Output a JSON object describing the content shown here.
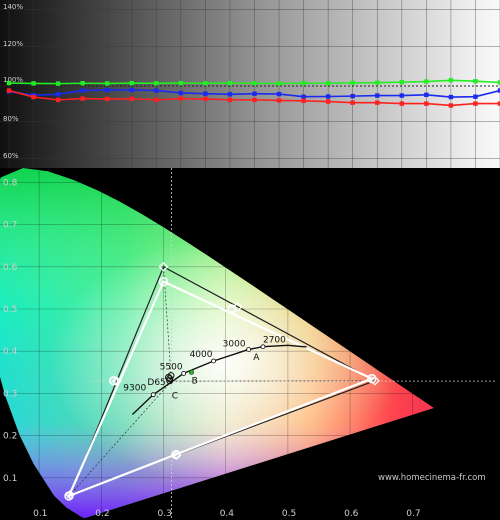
{
  "rgb_balance": {
    "y_ticks": [
      "140%",
      "120%",
      "100%",
      "80%",
      "60%"
    ],
    "colors": {
      "red": "#ff2020",
      "green": "#22ee22",
      "blue": "#1a2aee"
    }
  },
  "cie": {
    "x_ticks": [
      "0.1",
      "0.2",
      "0.3",
      "0.4",
      "0.5",
      "0.6",
      "0.7"
    ],
    "y_ticks": [
      "0.8",
      "0.7",
      "0.6",
      "0.5",
      "0.4",
      "0.3",
      "0.2",
      "0.1"
    ],
    "locus_labels": [
      "9300",
      "5500",
      "4000",
      "3000",
      "2700"
    ],
    "point_labels": [
      "D65",
      "A",
      "B",
      "C"
    ],
    "watermark": "www.homecinema-fr.com"
  },
  "chart_data": [
    {
      "type": "line",
      "xlabel": "",
      "ylabel": "",
      "ylim": [
        55,
        145
      ],
      "grid": true,
      "x": [
        0,
        1,
        2,
        3,
        4,
        5,
        6,
        7,
        8,
        9,
        10,
        11,
        12,
        13,
        14,
        15,
        16,
        17,
        18,
        19,
        20
      ],
      "series": [
        {
          "color": "#22ee22",
          "values": [
            100.5,
            100.3,
            100.2,
            100.4,
            100.3,
            100.5,
            100.4,
            100.5,
            100.4,
            100.5,
            100.4,
            100.3,
            100.4,
            100.4,
            100.6,
            100.7,
            101,
            101.3,
            102,
            101.5,
            100.8
          ]
        },
        {
          "color": "#1a2aee",
          "values": [
            96,
            94,
            94.5,
            96.5,
            96.8,
            96.8,
            96.5,
            95.2,
            94.8,
            94.5,
            94.8,
            94.6,
            93.2,
            93.3,
            93.5,
            93.8,
            93.8,
            94.2,
            93,
            93.2,
            96.5
          ]
        },
        {
          "color": "#ff2020",
          "values": [
            96.5,
            93,
            91.5,
            92.2,
            92,
            92.1,
            91.5,
            92.2,
            92,
            91.5,
            91.5,
            91.2,
            91,
            90.6,
            90,
            90,
            89.5,
            89.5,
            88.5,
            89.5,
            89.5
          ]
        }
      ]
    },
    {
      "type": "scatter",
      "xlabel": "",
      "ylabel": "",
      "xlim": [
        0.05,
        0.8
      ],
      "ylim": [
        0.0,
        0.85
      ],
      "grid": true,
      "reference_gamut": [
        [
          0.64,
          0.33
        ],
        [
          0.3,
          0.6
        ],
        [
          0.15,
          0.06
        ]
      ],
      "measured_gamut": [
        [
          0.635,
          0.335
        ],
        [
          0.3,
          0.565
        ],
        [
          0.148,
          0.057
        ]
      ],
      "reference_secondaries": [
        [
          0.225,
          0.329
        ],
        [
          0.321,
          0.154
        ],
        [
          0.419,
          0.505
        ]
      ],
      "measured_secondaries": [
        [
          0.22,
          0.33
        ],
        [
          0.32,
          0.155
        ],
        [
          0.41,
          0.5
        ]
      ],
      "white_point": [
        0.3127,
        0.329
      ],
      "measured_white_points": [
        [
          0.308,
          0.338
        ],
        [
          0.31,
          0.335
        ],
        [
          0.312,
          0.342
        ],
        [
          0.31,
          0.33
        ]
      ],
      "planckian_locus": [
        [
          0.25,
          0.25
        ],
        [
          0.2836,
          0.297
        ],
        [
          0.3324,
          0.3474
        ],
        [
          0.3805,
          0.3768
        ],
        [
          0.4369,
          0.4041
        ],
        [
          0.4599,
          0.4106
        ],
        [
          0.5,
          0.414
        ],
        [
          0.53,
          0.41
        ]
      ],
      "illuminants": [
        {
          "label": "A",
          "x": 0.4476,
          "y": 0.4074
        },
        {
          "label": "B",
          "x": 0.3484,
          "y": 0.3516
        },
        {
          "label": "C",
          "x": 0.3101,
          "y": 0.3162
        },
        {
          "label": "D65",
          "x": 0.3127,
          "y": 0.329
        }
      ]
    }
  ]
}
